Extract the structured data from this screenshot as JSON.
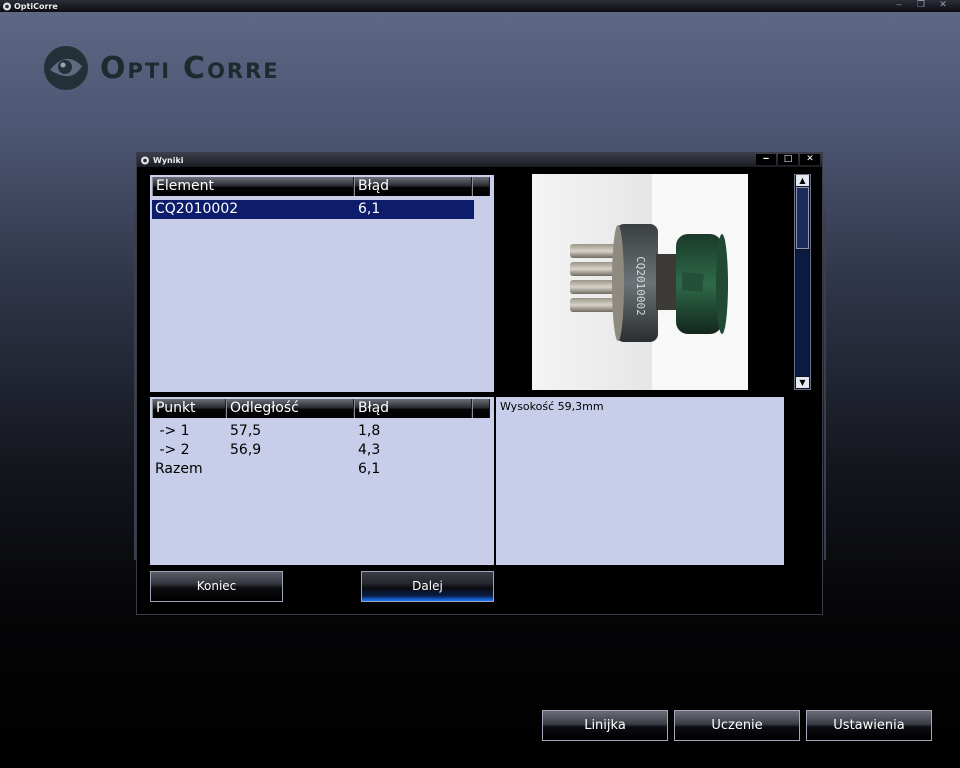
{
  "app": {
    "title": "OptiCorre"
  },
  "logo": {
    "part1_big": "O",
    "part1_small": "PTI",
    "part2_big": "C",
    "part2_small": "ORRE"
  },
  "dialog": {
    "title": "Wyniki",
    "controls": {
      "minimize": "‒",
      "maximize": "□",
      "close": "✕"
    },
    "results_table": {
      "columns": [
        "Element",
        "Błąd"
      ],
      "rows": [
        {
          "element": "CQ2010002",
          "error": "6,1",
          "selected": true
        }
      ]
    },
    "points_table": {
      "columns": [
        "Punkt",
        "Odległość",
        "Błąd"
      ],
      "rows": [
        {
          "point": " -> 1",
          "distance": "57,5",
          "error": "1,8"
        },
        {
          "point": " -> 2",
          "distance": "56,9",
          "error": "4,3"
        },
        {
          "point": "Razem",
          "distance": "",
          "error": "6,1"
        }
      ]
    },
    "info_text": "Wysokość 59,3mm",
    "photo": {
      "label": "CQ2010002"
    },
    "buttons": {
      "end": "Koniec",
      "next": "Dalej"
    }
  },
  "bottom_buttons": {
    "ruler": "Linijka",
    "learning": "Uczenie",
    "settings": "Ustawienia"
  },
  "colors": {
    "panel": "#c8cde9",
    "selection": "#0d1d6b",
    "accent_glow": "#1a78ff"
  }
}
